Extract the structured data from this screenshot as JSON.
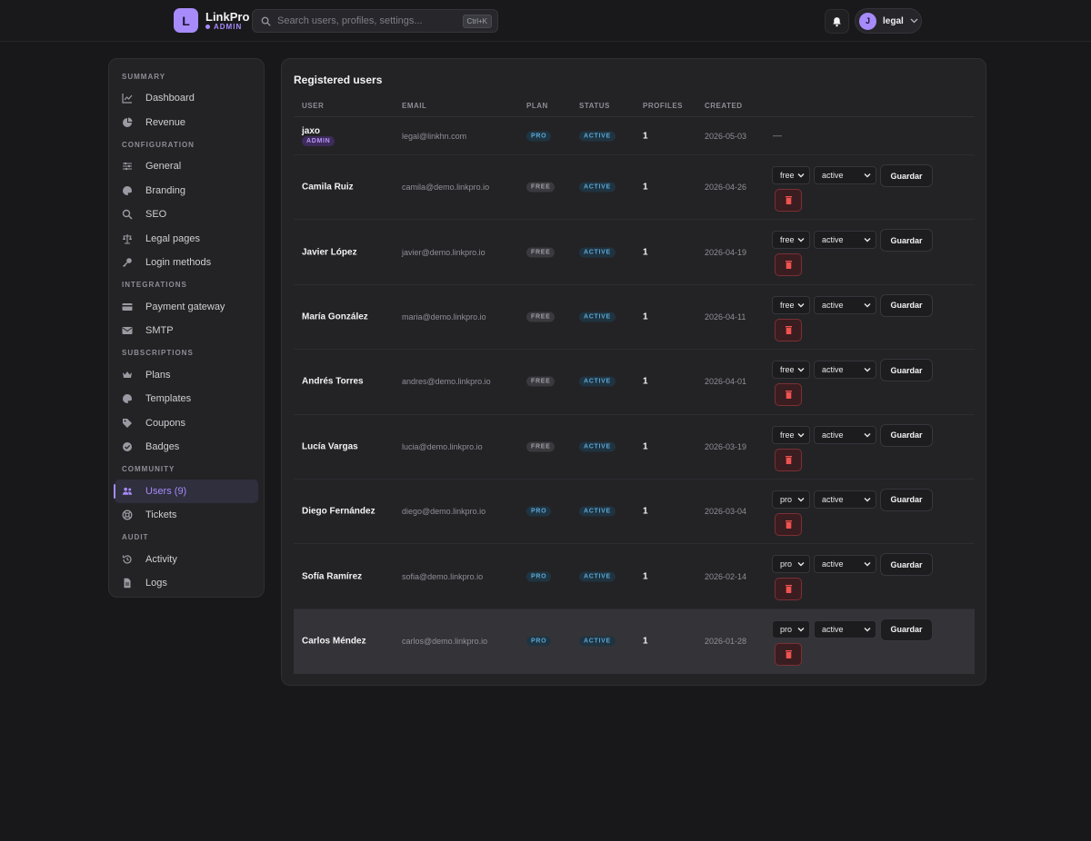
{
  "brand": {
    "logo_letter": "L",
    "name": "LinkPro",
    "sub": "ADMIN"
  },
  "search": {
    "placeholder": "Search users, profiles, settings...",
    "shortcut": "Ctrl+K"
  },
  "user_menu": {
    "avatar": "J",
    "name": "legal"
  },
  "sidebar": {
    "sections": [
      {
        "title": "SUMMARY",
        "items": [
          {
            "label": "Dashboard",
            "icon": "chart-line-icon"
          },
          {
            "label": "Revenue",
            "icon": "pie-chart-icon"
          }
        ]
      },
      {
        "title": "CONFIGURATION",
        "items": [
          {
            "label": "General",
            "icon": "sliders-icon"
          },
          {
            "label": "Branding",
            "icon": "palette-icon"
          },
          {
            "label": "SEO",
            "icon": "search-icon"
          },
          {
            "label": "Legal pages",
            "icon": "scale-icon"
          },
          {
            "label": "Login methods",
            "icon": "key-icon"
          }
        ]
      },
      {
        "title": "INTEGRATIONS",
        "items": [
          {
            "label": "Payment gateway",
            "icon": "credit-card-icon"
          },
          {
            "label": "SMTP",
            "icon": "envelope-icon"
          }
        ]
      },
      {
        "title": "SUBSCRIPTIONS",
        "items": [
          {
            "label": "Plans",
            "icon": "crown-icon"
          },
          {
            "label": "Templates",
            "icon": "palette-icon"
          },
          {
            "label": "Coupons",
            "icon": "tag-icon"
          },
          {
            "label": "Badges",
            "icon": "check-badge-icon"
          }
        ]
      },
      {
        "title": "COMMUNITY",
        "items": [
          {
            "label": "Users (9)",
            "icon": "users-icon",
            "active": true
          },
          {
            "label": "Tickets",
            "icon": "lifebuoy-icon"
          }
        ]
      },
      {
        "title": "AUDIT",
        "items": [
          {
            "label": "Activity",
            "icon": "history-icon"
          },
          {
            "label": "Logs",
            "icon": "file-icon"
          }
        ]
      }
    ]
  },
  "panel": {
    "title": "Registered users",
    "columns": [
      "USER",
      "EMAIL",
      "PLAN",
      "STATUS",
      "PROFILES",
      "CREATED"
    ],
    "admin_row": {
      "user": "jaxo",
      "role_badge": "ADMIN",
      "email": "legal@linkhn.com",
      "plan": "PRO",
      "status": "ACTIVE",
      "profiles": "1",
      "created": "2026-05-03",
      "actions": "—"
    },
    "rows": [
      {
        "user": "Camila Ruiz",
        "email": "camila@demo.linkpro.io",
        "plan": "FREE",
        "status": "ACTIVE",
        "profiles": "1",
        "created": "2026-04-26",
        "plan_select": "free",
        "status_select": "active",
        "save_label": "Guardar"
      },
      {
        "user": "Javier López",
        "email": "javier@demo.linkpro.io",
        "plan": "FREE",
        "status": "ACTIVE",
        "profiles": "1",
        "created": "2026-04-19",
        "plan_select": "free",
        "status_select": "active",
        "save_label": "Guardar"
      },
      {
        "user": "María González",
        "email": "maria@demo.linkpro.io",
        "plan": "FREE",
        "status": "ACTIVE",
        "profiles": "1",
        "created": "2026-04-11",
        "plan_select": "free",
        "status_select": "active",
        "save_label": "Guardar"
      },
      {
        "user": "Andrés Torres",
        "email": "andres@demo.linkpro.io",
        "plan": "FREE",
        "status": "ACTIVE",
        "profiles": "1",
        "created": "2026-04-01",
        "plan_select": "free",
        "status_select": "active",
        "save_label": "Guardar"
      },
      {
        "user": "Lucía Vargas",
        "email": "lucia@demo.linkpro.io",
        "plan": "FREE",
        "status": "ACTIVE",
        "profiles": "1",
        "created": "2026-03-19",
        "plan_select": "free",
        "status_select": "active",
        "save_label": "Guardar"
      },
      {
        "user": "Diego Fernández",
        "email": "diego@demo.linkpro.io",
        "plan": "PRO",
        "status": "ACTIVE",
        "profiles": "1",
        "created": "2026-03-04",
        "plan_select": "pro",
        "status_select": "active",
        "save_label": "Guardar"
      },
      {
        "user": "Sofía Ramírez",
        "email": "sofia@demo.linkpro.io",
        "plan": "PRO",
        "status": "ACTIVE",
        "profiles": "1",
        "created": "2026-02-14",
        "plan_select": "pro",
        "status_select": "active",
        "save_label": "Guardar"
      },
      {
        "user": "Carlos Méndez",
        "email": "carlos@demo.linkpro.io",
        "plan": "PRO",
        "status": "ACTIVE",
        "profiles": "1",
        "created": "2026-01-28",
        "plan_select": "pro",
        "status_select": "active",
        "save_label": "Guardar",
        "highlighted": true
      }
    ]
  },
  "colors": {
    "accent": "#a78bfa",
    "background": "#18181a",
    "panel": "#232326",
    "danger": "#ef5350",
    "info": "#5ba7d6"
  }
}
